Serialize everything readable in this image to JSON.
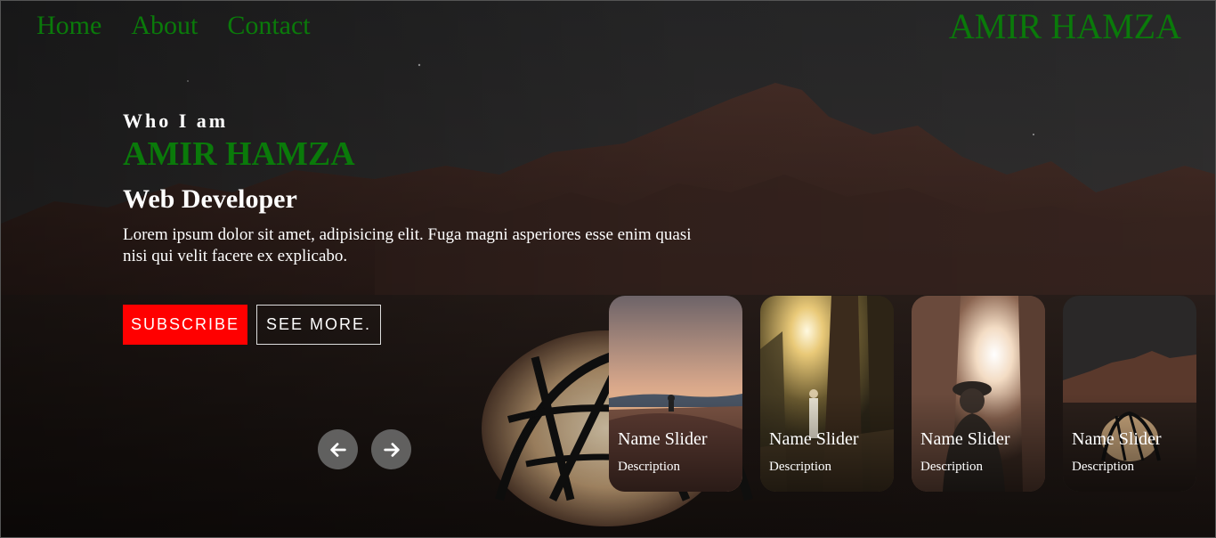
{
  "nav": {
    "links": [
      "Home",
      "About",
      "Contact"
    ],
    "brand": "AMIR HAMZA"
  },
  "hero": {
    "eyebrow": "Who I am",
    "name": "AMIR HAMZA",
    "role": "Web Developer",
    "description": "Lorem ipsum dolor sit amet, adipisicing elit. Fuga magni asperiores esse enim quasi nisi qui velit facere ex explicabo.",
    "subscribe_label": "SUBSCRIBE",
    "see_more_label": "SEE MORE."
  },
  "slider": {
    "prev_icon": "arrow-left-icon",
    "next_icon": "arrow-right-icon",
    "cards": [
      {
        "title": "Name Slider",
        "description": "Description",
        "scene": "desert-sunset"
      },
      {
        "title": "Name Slider",
        "description": "Description",
        "scene": "palm-sun"
      },
      {
        "title": "Name Slider",
        "description": "Description",
        "scene": "canyon-light"
      },
      {
        "title": "Name Slider",
        "description": "Description",
        "scene": "mountain-tent"
      }
    ]
  },
  "colors": {
    "accent_green": "#0a7a0a",
    "subscribe_red": "#ff0000",
    "background": "#0e0b0a"
  }
}
